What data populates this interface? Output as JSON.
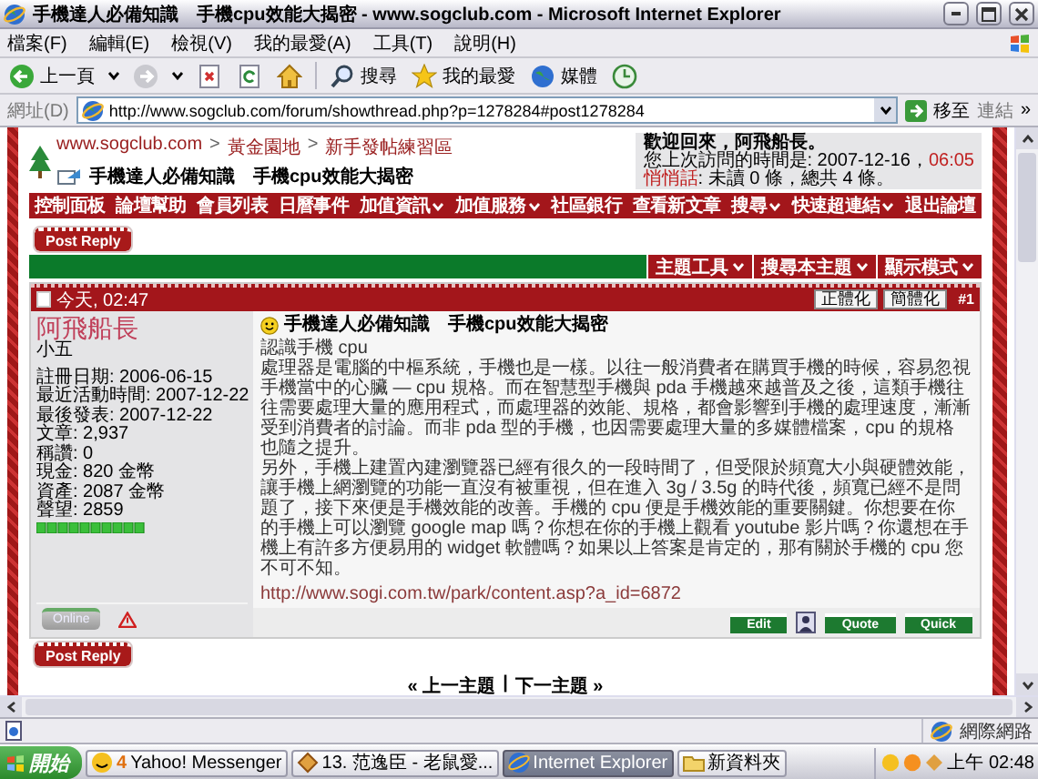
{
  "window": {
    "title": "手機達人必備知識　手機cpu效能大揭密 - www.sogclub.com - Microsoft Internet Explorer"
  },
  "menu": [
    "檔案(F)",
    "編輯(E)",
    "檢視(V)",
    "我的最愛(A)",
    "工具(T)",
    "說明(H)"
  ],
  "toolbar": [
    {
      "kind": "back",
      "label": "上一頁"
    },
    {
      "kind": "forward"
    },
    {
      "kind": "stop"
    },
    {
      "kind": "refresh"
    },
    {
      "kind": "home"
    },
    {
      "kind": "search",
      "label": "搜尋"
    },
    {
      "kind": "favorites",
      "label": "我的最愛"
    },
    {
      "kind": "media",
      "label": "媒體"
    },
    {
      "kind": "history"
    }
  ],
  "address_bar": {
    "label": "網址(D)",
    "url": "http://www.sogclub.com/forum/showthread.php?p=1278284#post1278284",
    "go": "移至",
    "links": "連結",
    "more": "»"
  },
  "page": {
    "breadcrumb": [
      {
        "kind": "link",
        "label": "www.sogclub.com"
      },
      {
        "kind": "separator",
        "label": ">"
      },
      {
        "kind": "link",
        "label": "黃金園地"
      },
      {
        "kind": "separator",
        "label": ">"
      },
      {
        "kind": "link",
        "label": "新手發帖練習區"
      }
    ],
    "thread_title": "手機達人必備知識　手機cpu效能大揭密",
    "welcome": {
      "greeting": "歡迎回來，阿飛船長。",
      "last_visit": "您上次訪問的時間是: 2007-12-16，",
      "last_visit_time": "06:05",
      "messages_link": "悄悄話",
      "messages": ": 未讀 0 條，總共 4 條。"
    },
    "nav": [
      {
        "label": "控制面板",
        "dropdown": false
      },
      {
        "label": "論壇幫助",
        "dropdown": false
      },
      {
        "label": "會員列表",
        "dropdown": false
      },
      {
        "label": "日曆事件",
        "dropdown": false
      },
      {
        "label": "加值資訊",
        "dropdown": true
      },
      {
        "label": "加值服務",
        "dropdown": true
      },
      {
        "label": "社區銀行",
        "dropdown": false
      },
      {
        "label": "查看新文章",
        "dropdown": false
      },
      {
        "label": "搜尋",
        "dropdown": true
      },
      {
        "label": "快速超連結",
        "dropdown": true
      },
      {
        "label": "退出論壇",
        "dropdown": false
      }
    ],
    "post_reply_top": "Post Reply",
    "thread_tools": [
      {
        "label": "主題工具"
      },
      {
        "label": "搜尋本主題"
      },
      {
        "label": "顯示模式"
      }
    ],
    "post": {
      "date": "今天, 02:47",
      "convert_buttons": [
        "正體化",
        "簡體化"
      ],
      "number": "#1",
      "author": "阿飛船長",
      "rank": "小五",
      "stats": [
        "註冊日期: 2006-06-15",
        "最近活動時間: 2007-12-22",
        "最後發表: 2007-12-22",
        "文章: 2,937",
        "稱讚: 0",
        "現金: 820 金幣",
        "資產: 2087 金幣",
        "聲望: 2859"
      ],
      "title": "手機達人必備知識　手機cpu效能大揭密",
      "body": [
        "認識手機 cpu",
        "處理器是電腦的中樞系統，手機也是一樣。以往一般消費者在購買手機的時候，容易忽視手機當中的心臟 — cpu 規格。而在智慧型手機與 pda 手機越來越普及之後，這類手機往往需要處理大量的應用程式，而處理器的效能、規格，都會影響到手機的處理速度，漸漸受到消費者的討論。而非 pda 型的手機，也因需要處理大量的多媒體檔案，cpu 的規格也隨之提升。",
        "另外，手機上建置內建瀏覽器已經有很久的一段時間了，但受限於頻寬大小與硬體效能，讓手機上網瀏覽的功能一直沒有被重視，但在進入 3g / 3.5g 的時代後，頻寬已經不是問題了，接下來便是手機效能的改善。手機的 cpu 便是手機效能的重要關鍵。你想要在你的手機上可以瀏覽 google map 嗎？你想在你的手機上觀看 youtube 影片嗎？你還想在手機上有許多方便易用的 widget 軟體嗎？如果以上答案是肯定的，那有關於手機的 cpu 您不可不知。"
      ],
      "link": "http://www.sogi.com.tw/park/content.asp?a_id=6872",
      "online": "Online",
      "actions": [
        {
          "kind": "button",
          "label": "Edit"
        },
        {
          "kind": "profile"
        },
        {
          "kind": "button",
          "label": "Quote"
        },
        {
          "kind": "button",
          "label": "Quick"
        }
      ]
    },
    "post_reply_bottom": "Post Reply",
    "thread_nav": {
      "prev": "« 上一主題",
      "separator": "|",
      "next": "下一主題 »"
    }
  },
  "status_bar": {
    "zone": "網際網路"
  },
  "taskbar": {
    "start": "開始",
    "items": [
      {
        "badge": "4",
        "label": "Yahoo! Messenger",
        "selected": false
      },
      {
        "label": "13. 范逸臣 - 老鼠愛...",
        "selected": false
      },
      {
        "label": "Internet Explorer",
        "selected": true
      },
      {
        "label": "新資料夾",
        "selected": false
      }
    ],
    "clock": "上午 02:48"
  }
}
